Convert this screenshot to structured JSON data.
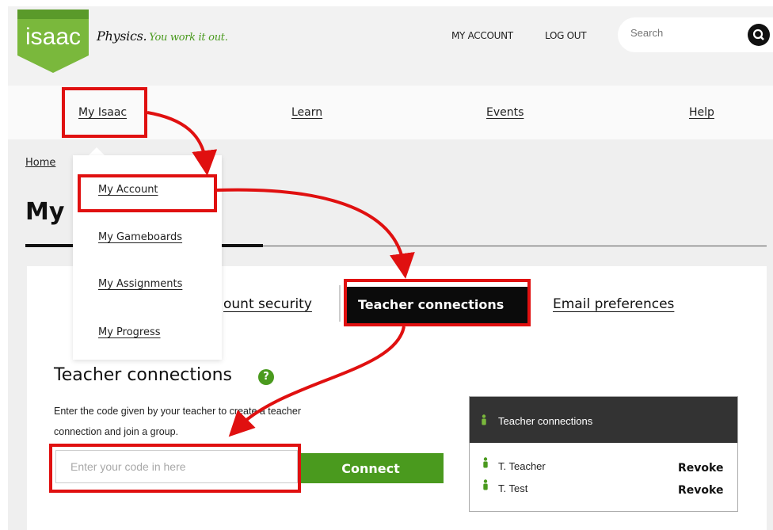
{
  "header": {
    "logo_text": "isaac",
    "tagline_main": "Physics.",
    "tagline_sub": "You work it out.",
    "links": {
      "account": "MY ACCOUNT",
      "logout": "LOG OUT"
    },
    "search_placeholder": "Search"
  },
  "nav": {
    "my_isaac": "My Isaac",
    "learn": "Learn",
    "events": "Events",
    "help": "Help"
  },
  "dropdown": {
    "items": [
      {
        "label": "My Account"
      },
      {
        "label": "My Gameboards"
      },
      {
        "label": "My Assignments"
      },
      {
        "label": "My Progress"
      }
    ]
  },
  "breadcrumb": {
    "home": "Home"
  },
  "page": {
    "title": "My"
  },
  "tabs": {
    "security": "ount security",
    "teacher": "Teacher connections",
    "email": "Email preferences"
  },
  "section": {
    "title": "Teacher connections",
    "help_glyph": "?",
    "desc_line1": "Enter the code given by your teacher to create a teacher",
    "desc_line2": "connection and join a group.",
    "input_placeholder": "Enter your code in here",
    "connect_label": "Connect"
  },
  "panel": {
    "title": "Teacher connections",
    "rows": [
      {
        "name": "T. Teacher",
        "action": "Revoke"
      },
      {
        "name": "T. Test",
        "action": "Revoke"
      }
    ]
  },
  "colors": {
    "brand_green": "#4a9a1e",
    "highlight_red": "#e01010",
    "dark": "#0b0b0b"
  }
}
